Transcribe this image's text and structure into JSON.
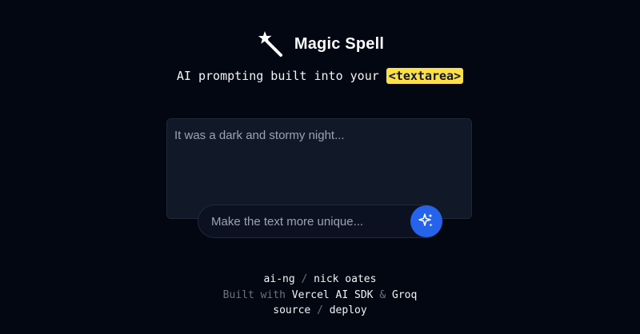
{
  "header": {
    "icon": "magic-wand-icon",
    "title": "Magic Spell"
  },
  "tagline": {
    "text": "AI prompting built into your",
    "code": "<textarea>"
  },
  "editor": {
    "text": "It was a dark and stormy night..."
  },
  "prompt": {
    "placeholder": "Make the text more unique...",
    "value": "",
    "button_icon": "sparkles-icon"
  },
  "footer": {
    "line1": {
      "link1": "ai-ng",
      "sep": " / ",
      "link2": "nick oates"
    },
    "line2": {
      "prefix": "Built with ",
      "link1": "Vercel AI SDK",
      "sep": " & ",
      "link2": "Groq"
    },
    "line3": {
      "link1": "source",
      "sep": " / ",
      "link2": "deploy"
    }
  },
  "colors": {
    "background": "#030712",
    "accent": "#2563eb",
    "highlight": "#fde047"
  }
}
